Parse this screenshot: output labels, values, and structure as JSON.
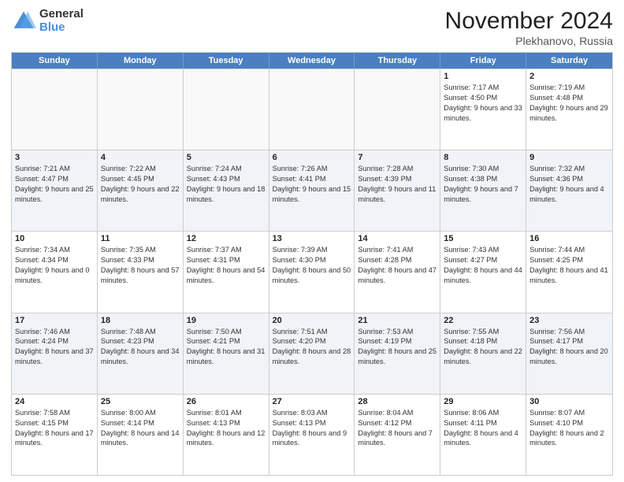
{
  "logo": {
    "general": "General",
    "blue": "Blue"
  },
  "title": "November 2024",
  "location": "Plekhanovo, Russia",
  "header": {
    "days": [
      "Sunday",
      "Monday",
      "Tuesday",
      "Wednesday",
      "Thursday",
      "Friday",
      "Saturday"
    ]
  },
  "rows": [
    [
      {
        "day": "",
        "info": ""
      },
      {
        "day": "",
        "info": ""
      },
      {
        "day": "",
        "info": ""
      },
      {
        "day": "",
        "info": ""
      },
      {
        "day": "",
        "info": ""
      },
      {
        "day": "1",
        "info": "Sunrise: 7:17 AM\nSunset: 4:50 PM\nDaylight: 9 hours and 33 minutes."
      },
      {
        "day": "2",
        "info": "Sunrise: 7:19 AM\nSunset: 4:48 PM\nDaylight: 9 hours and 29 minutes."
      }
    ],
    [
      {
        "day": "3",
        "info": "Sunrise: 7:21 AM\nSunset: 4:47 PM\nDaylight: 9 hours and 25 minutes."
      },
      {
        "day": "4",
        "info": "Sunrise: 7:22 AM\nSunset: 4:45 PM\nDaylight: 9 hours and 22 minutes."
      },
      {
        "day": "5",
        "info": "Sunrise: 7:24 AM\nSunset: 4:43 PM\nDaylight: 9 hours and 18 minutes."
      },
      {
        "day": "6",
        "info": "Sunrise: 7:26 AM\nSunset: 4:41 PM\nDaylight: 9 hours and 15 minutes."
      },
      {
        "day": "7",
        "info": "Sunrise: 7:28 AM\nSunset: 4:39 PM\nDaylight: 9 hours and 11 minutes."
      },
      {
        "day": "8",
        "info": "Sunrise: 7:30 AM\nSunset: 4:38 PM\nDaylight: 9 hours and 7 minutes."
      },
      {
        "day": "9",
        "info": "Sunrise: 7:32 AM\nSunset: 4:36 PM\nDaylight: 9 hours and 4 minutes."
      }
    ],
    [
      {
        "day": "10",
        "info": "Sunrise: 7:34 AM\nSunset: 4:34 PM\nDaylight: 9 hours and 0 minutes."
      },
      {
        "day": "11",
        "info": "Sunrise: 7:35 AM\nSunset: 4:33 PM\nDaylight: 8 hours and 57 minutes."
      },
      {
        "day": "12",
        "info": "Sunrise: 7:37 AM\nSunset: 4:31 PM\nDaylight: 8 hours and 54 minutes."
      },
      {
        "day": "13",
        "info": "Sunrise: 7:39 AM\nSunset: 4:30 PM\nDaylight: 8 hours and 50 minutes."
      },
      {
        "day": "14",
        "info": "Sunrise: 7:41 AM\nSunset: 4:28 PM\nDaylight: 8 hours and 47 minutes."
      },
      {
        "day": "15",
        "info": "Sunrise: 7:43 AM\nSunset: 4:27 PM\nDaylight: 8 hours and 44 minutes."
      },
      {
        "day": "16",
        "info": "Sunrise: 7:44 AM\nSunset: 4:25 PM\nDaylight: 8 hours and 41 minutes."
      }
    ],
    [
      {
        "day": "17",
        "info": "Sunrise: 7:46 AM\nSunset: 4:24 PM\nDaylight: 8 hours and 37 minutes."
      },
      {
        "day": "18",
        "info": "Sunrise: 7:48 AM\nSunset: 4:23 PM\nDaylight: 8 hours and 34 minutes."
      },
      {
        "day": "19",
        "info": "Sunrise: 7:50 AM\nSunset: 4:21 PM\nDaylight: 8 hours and 31 minutes."
      },
      {
        "day": "20",
        "info": "Sunrise: 7:51 AM\nSunset: 4:20 PM\nDaylight: 8 hours and 28 minutes."
      },
      {
        "day": "21",
        "info": "Sunrise: 7:53 AM\nSunset: 4:19 PM\nDaylight: 8 hours and 25 minutes."
      },
      {
        "day": "22",
        "info": "Sunrise: 7:55 AM\nSunset: 4:18 PM\nDaylight: 8 hours and 22 minutes."
      },
      {
        "day": "23",
        "info": "Sunrise: 7:56 AM\nSunset: 4:17 PM\nDaylight: 8 hours and 20 minutes."
      }
    ],
    [
      {
        "day": "24",
        "info": "Sunrise: 7:58 AM\nSunset: 4:15 PM\nDaylight: 8 hours and 17 minutes."
      },
      {
        "day": "25",
        "info": "Sunrise: 8:00 AM\nSunset: 4:14 PM\nDaylight: 8 hours and 14 minutes."
      },
      {
        "day": "26",
        "info": "Sunrise: 8:01 AM\nSunset: 4:13 PM\nDaylight: 8 hours and 12 minutes."
      },
      {
        "day": "27",
        "info": "Sunrise: 8:03 AM\nSunset: 4:13 PM\nDaylight: 8 hours and 9 minutes."
      },
      {
        "day": "28",
        "info": "Sunrise: 8:04 AM\nSunset: 4:12 PM\nDaylight: 8 hours and 7 minutes."
      },
      {
        "day": "29",
        "info": "Sunrise: 8:06 AM\nSunset: 4:11 PM\nDaylight: 8 hours and 4 minutes."
      },
      {
        "day": "30",
        "info": "Sunrise: 8:07 AM\nSunset: 4:10 PM\nDaylight: 8 hours and 2 minutes."
      }
    ]
  ]
}
